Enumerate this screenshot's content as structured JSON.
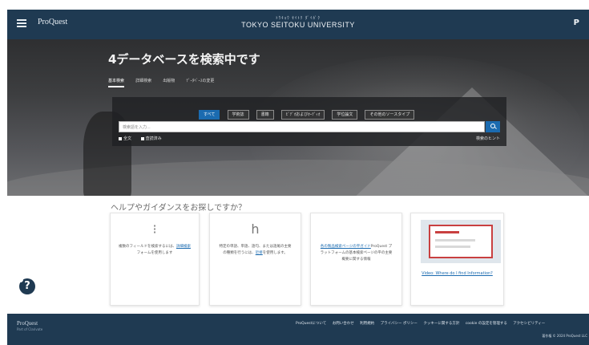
{
  "header": {
    "logo": "ProQuest",
    "institution_small": "ﾄｳｷｮｳ ｾｲﾄｸ ﾀﾞｲｶﾞｸ",
    "institution": "TOKYO SEITOKU UNIVERSITY",
    "user_initial": "P"
  },
  "hero": {
    "title": "4データベースを検索中です",
    "tabs": [
      "基本検索",
      "詳細検索",
      "出版物",
      "ﾃﾞｰﾀﾍﾞｰｽの変更"
    ],
    "source_chips": [
      "すべて",
      "学術誌",
      "書籍",
      "ﾋﾞﾃﾞｵおよびｵｰﾃﾞｨｵ",
      "学位論文",
      "その他のソースタイプ"
    ],
    "search_placeholder": "検索語を入力...",
    "checkbox_full_text": "全文",
    "checkbox_peer_reviewed": "査読済み",
    "search_tips": "検索のヒント"
  },
  "help": {
    "title": "ヘルプやガイダンスをお探しですか？",
    "card1_text": "複数のフィールドを検索するには、",
    "card1_link": "詳細検索",
    "card1_text2": "フォームを使用します",
    "card2_text": "特定の単語、単語、語句、または語尾の主要の種類を行うには、",
    "card2_link": "近接",
    "card2_text2": "を使用します。",
    "card3_link": "各の製品検索ページの平ガイド",
    "card3_text": "ProQuest プラットフォームの基本検索ページの平の主要概要に関する情報",
    "video_caption": "Video: Where do I find Information?"
  },
  "footer": {
    "logo": "ProQuest",
    "sub": "Part of Clarivate",
    "links": [
      "ProQuestについて",
      "お問い合わせ",
      "利用規約",
      "プライバシー ポリシー",
      "クッキーに関する方針",
      "cookie の設定を管理する",
      "アクセシビリティー"
    ],
    "copyright": "著作権 © 2024 ProQuest LLC"
  }
}
